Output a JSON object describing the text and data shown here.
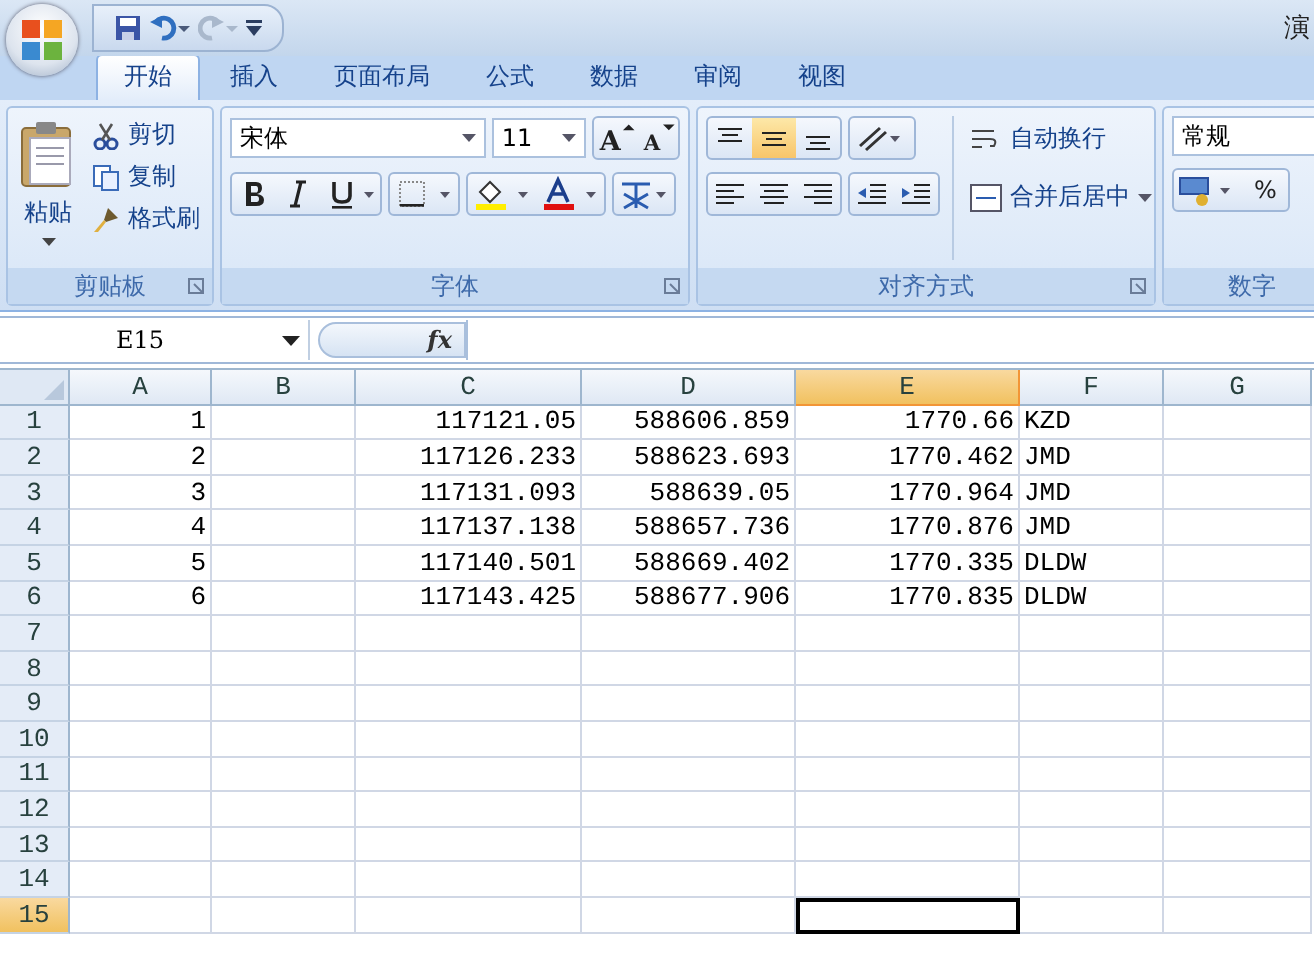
{
  "window": {
    "title": "演"
  },
  "tabs": [
    {
      "label": "开始",
      "selected": true
    },
    {
      "label": "插入",
      "selected": false
    },
    {
      "label": "页面布局",
      "selected": false
    },
    {
      "label": "公式",
      "selected": false
    },
    {
      "label": "数据",
      "selected": false
    },
    {
      "label": "审阅",
      "selected": false
    },
    {
      "label": "视图",
      "selected": false
    }
  ],
  "clipboard": {
    "paste_label": "粘贴",
    "items": [
      {
        "kind": "cut",
        "label": "剪切"
      },
      {
        "kind": "copy",
        "label": "复制"
      },
      {
        "kind": "painter",
        "label": "格式刷"
      }
    ],
    "group_label": "剪贴板"
  },
  "font": {
    "font_name": "宋体",
    "font_size": "11",
    "grow_label": "A",
    "shrink_label": "A",
    "group_label": "字体"
  },
  "alignment": {
    "vertical_buttons": [
      {
        "kind": "top",
        "selected": false
      },
      {
        "kind": "middle",
        "selected": true
      },
      {
        "kind": "bottom",
        "selected": false
      }
    ],
    "wrap_label": "自动换行",
    "merge_label": "合并后居中",
    "group_label": "对齐方式"
  },
  "number": {
    "format": "常规",
    "percent": "%",
    "group_label": "数字"
  },
  "formula_bar": {
    "name_box": "E15",
    "function_label": "fx"
  },
  "columns": [
    {
      "label": "A",
      "selected": false
    },
    {
      "label": "B",
      "selected": false
    },
    {
      "label": "C",
      "selected": false
    },
    {
      "label": "D",
      "selected": false
    },
    {
      "label": "E",
      "selected": true
    },
    {
      "label": "F",
      "selected": false
    },
    {
      "label": "G",
      "selected": false
    }
  ],
  "rows": [
    {
      "label": "1",
      "selected": false,
      "cells": [
        {
          "text": "1",
          "kind": "number"
        },
        null,
        {
          "text": "117121.05",
          "kind": "number"
        },
        {
          "text": "588606.859",
          "kind": "number"
        },
        {
          "text": "1770.66",
          "kind": "number"
        },
        {
          "text": "KZD",
          "kind": "text"
        },
        null
      ]
    },
    {
      "label": "2",
      "selected": false,
      "cells": [
        {
          "text": "2",
          "kind": "number"
        },
        null,
        {
          "text": "117126.233",
          "kind": "number"
        },
        {
          "text": "588623.693",
          "kind": "number"
        },
        {
          "text": "1770.462",
          "kind": "number"
        },
        {
          "text": "JMD",
          "kind": "text"
        },
        null
      ]
    },
    {
      "label": "3",
      "selected": false,
      "cells": [
        {
          "text": "3",
          "kind": "number"
        },
        null,
        {
          "text": "117131.093",
          "kind": "number"
        },
        {
          "text": "588639.05",
          "kind": "number"
        },
        {
          "text": "1770.964",
          "kind": "number"
        },
        {
          "text": "JMD",
          "kind": "text"
        },
        null
      ]
    },
    {
      "label": "4",
      "selected": false,
      "cells": [
        {
          "text": "4",
          "kind": "number"
        },
        null,
        {
          "text": "117137.138",
          "kind": "number"
        },
        {
          "text": "588657.736",
          "kind": "number"
        },
        {
          "text": "1770.876",
          "kind": "number"
        },
        {
          "text": "JMD",
          "kind": "text"
        },
        null
      ]
    },
    {
      "label": "5",
      "selected": false,
      "cells": [
        {
          "text": "5",
          "kind": "number"
        },
        null,
        {
          "text": "117140.501",
          "kind": "number"
        },
        {
          "text": "588669.402",
          "kind": "number"
        },
        {
          "text": "1770.335",
          "kind": "number"
        },
        {
          "text": "DLDW",
          "kind": "text"
        },
        null
      ]
    },
    {
      "label": "6",
      "selected": false,
      "cells": [
        {
          "text": "6",
          "kind": "number"
        },
        null,
        {
          "text": "117143.425",
          "kind": "number"
        },
        {
          "text": "588677.906",
          "kind": "number"
        },
        {
          "text": "1770.835",
          "kind": "number"
        },
        {
          "text": "DLDW",
          "kind": "text"
        },
        null
      ]
    },
    {
      "label": "7",
      "selected": false,
      "cells": []
    },
    {
      "label": "8",
      "selected": false,
      "cells": []
    },
    {
      "label": "9",
      "selected": false,
      "cells": []
    },
    {
      "label": "10",
      "selected": false,
      "cells": []
    },
    {
      "label": "11",
      "selected": false,
      "cells": []
    },
    {
      "label": "12",
      "selected": false,
      "cells": []
    },
    {
      "label": "13",
      "selected": false,
      "cells": []
    },
    {
      "label": "14",
      "selected": false,
      "cells": []
    },
    {
      "label": "15",
      "selected": true,
      "cells": []
    }
  ]
}
